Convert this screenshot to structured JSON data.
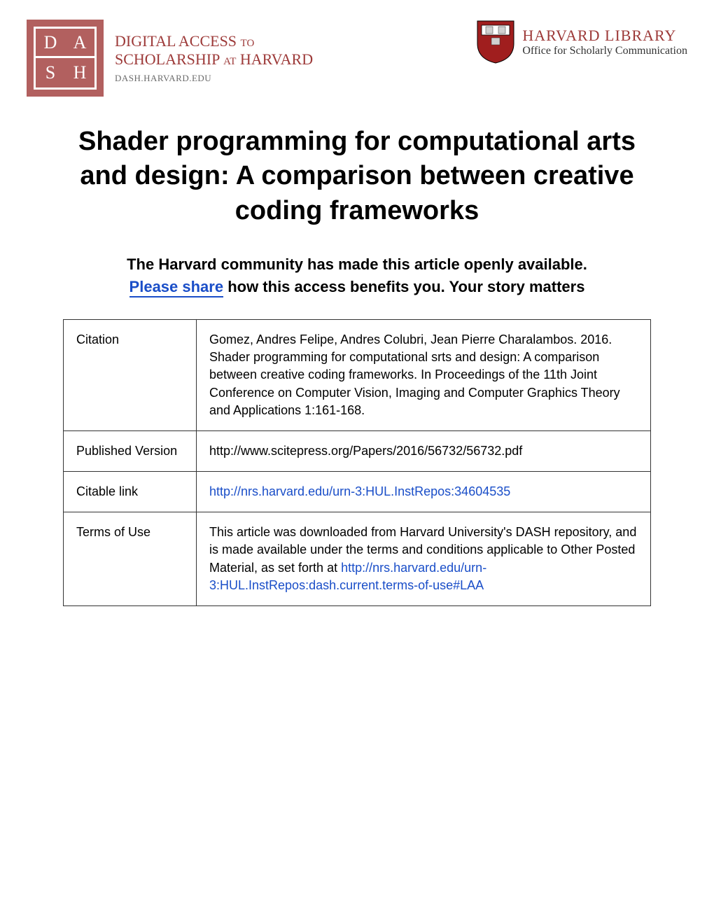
{
  "header": {
    "dash_logo": {
      "d": "D",
      "a": "A",
      "s": "S",
      "h": "H"
    },
    "dash_text": {
      "line1_pre": "DIGITAL ACCESS",
      "line1_small": "TO",
      "line2_pre": "SCHOLARSHIP",
      "line2_small": "AT",
      "line2_post": "HARVARD",
      "url": "DASH.HARVARD.EDU"
    },
    "harvard": {
      "line1": "HARVARD LIBRARY",
      "line2": "Office for Scholarly Communication"
    }
  },
  "title": "Shader programming for computational arts and design: A comparison between creative coding frameworks",
  "subtitle": {
    "part1": "The Harvard community has made this article openly available.  ",
    "link_text": "Please share",
    "part2": "  how this access benefits you. Your story matters"
  },
  "table": {
    "rows": [
      {
        "label": "Citation",
        "text": "Gomez, Andres Felipe, Andres Colubri, Jean Pierre Charalambos. 2016. Shader programming for computational srts and design: A comparison between creative coding frameworks. In Proceedings of the 11th Joint Conference on Computer Vision, Imaging and Computer Graphics Theory and Applications 1:161-168."
      },
      {
        "label": "Published Version",
        "text": "http://www.scitepress.org/Papers/2016/56732/56732.pdf"
      },
      {
        "label": "Citable link",
        "link": "http://nrs.harvard.edu/urn-3:HUL.InstRepos:34604535"
      },
      {
        "label": "Terms of Use",
        "text_pre": "This article was downloaded from Harvard University's DASH repository, and is made available under the terms and conditions applicable to Other Posted Material, as set forth at ",
        "link": "http://nrs.harvard.edu/urn-3:HUL.InstRepos:dash.current.terms-of-use#LAA"
      }
    ]
  }
}
